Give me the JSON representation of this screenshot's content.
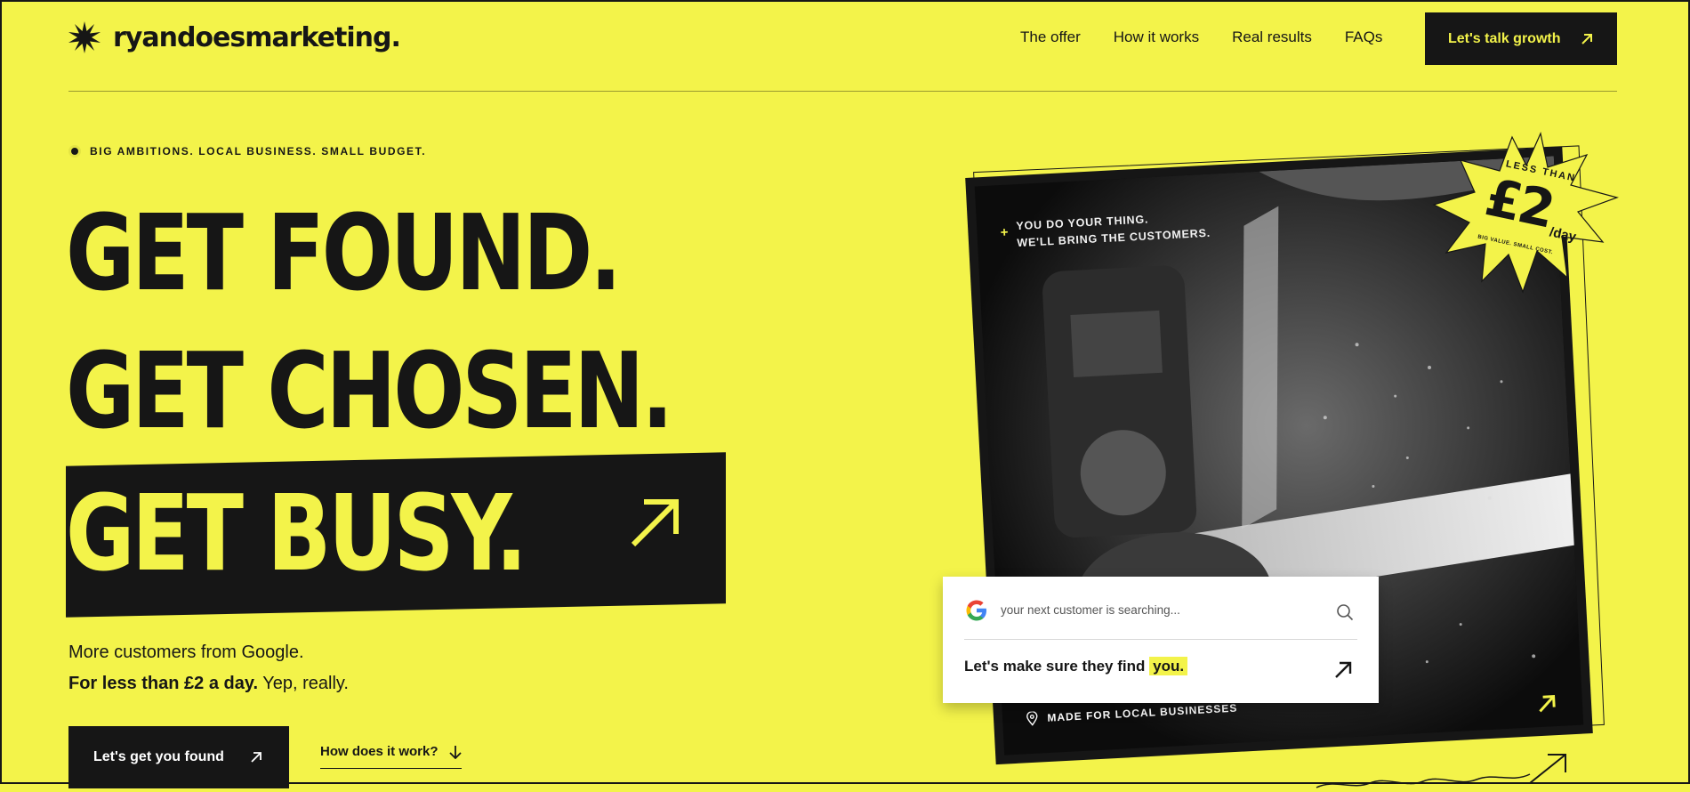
{
  "brand": {
    "name": "ryandoesmarketing."
  },
  "nav": {
    "items": [
      "The offer",
      "How it works",
      "Real results",
      "FAQs"
    ],
    "cta_label": "Let's talk growth"
  },
  "hero": {
    "tagline": "BIG AMBITIONS. LOCAL BUSINESS. SMALL BUDGET.",
    "line1": "GET FOUND.",
    "line2": "GET CHOSEN.",
    "line3": "GET BUSY.",
    "sub1": "More customers from Google.",
    "sub2_bold": "For less than £2 a day.",
    "sub2_rest": " Yep, really.",
    "primary_cta": "Let's get you found",
    "secondary_cta": "How does it work?"
  },
  "photo_card": {
    "caption_line1": "YOU DO YOUR THING.",
    "caption_line2": "WE'LL BRING THE CUSTOMERS.",
    "local_label": "MADE FOR LOCAL BUSINESSES"
  },
  "search_card": {
    "placeholder": "your next customer is searching...",
    "find_text": "Let's make sure they find ",
    "find_highlight": "you."
  },
  "badge": {
    "top": "LESS THAN",
    "price": "£2",
    "unit": "/day",
    "small": "BIG VALUE. SMALL COST."
  },
  "colors": {
    "accent": "#f3f34a",
    "ink": "#161616"
  }
}
